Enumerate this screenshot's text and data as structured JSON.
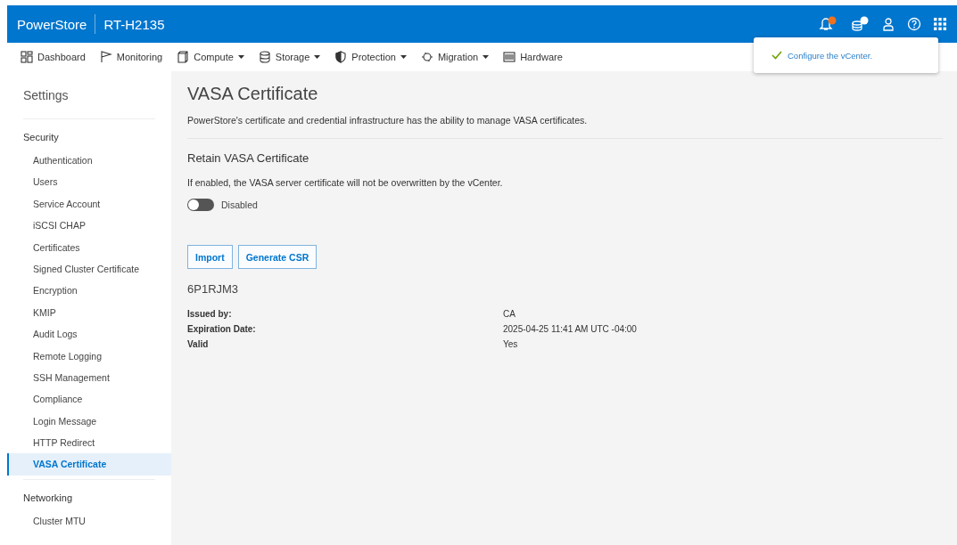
{
  "header": {
    "product": "PowerStore",
    "system": "RT-H2135"
  },
  "nav": [
    {
      "label": "Dashboard",
      "has_menu": false
    },
    {
      "label": "Monitoring",
      "has_menu": false
    },
    {
      "label": "Compute",
      "has_menu": true
    },
    {
      "label": "Storage",
      "has_menu": true
    },
    {
      "label": "Protection",
      "has_menu": true
    },
    {
      "label": "Migration",
      "has_menu": true
    },
    {
      "label": "Hardware",
      "has_menu": false
    }
  ],
  "toast": {
    "message": "Configure the vCenter."
  },
  "sidebar": {
    "title": "Settings",
    "sections": [
      {
        "title": "Security",
        "items": [
          {
            "label": "Authentication",
            "selected": false
          },
          {
            "label": "Users",
            "selected": false
          },
          {
            "label": "Service Account",
            "selected": false
          },
          {
            "label": "iSCSI CHAP",
            "selected": false
          },
          {
            "label": "Certificates",
            "selected": false
          },
          {
            "label": "Signed Cluster Certificate",
            "selected": false
          },
          {
            "label": "Encryption",
            "selected": false
          },
          {
            "label": "KMIP",
            "selected": false
          },
          {
            "label": "Audit Logs",
            "selected": false
          },
          {
            "label": "Remote Logging",
            "selected": false
          },
          {
            "label": "SSH Management",
            "selected": false
          },
          {
            "label": "Compliance",
            "selected": false
          },
          {
            "label": "Login Message",
            "selected": false
          },
          {
            "label": "HTTP Redirect",
            "selected": false
          },
          {
            "label": "VASA Certificate",
            "selected": true
          }
        ]
      },
      {
        "title": "Networking",
        "items": [
          {
            "label": "Cluster MTU",
            "selected": false
          }
        ]
      }
    ]
  },
  "page": {
    "title": "VASA Certificate",
    "description": "PowerStore's certificate and credential infrastructure has the ability to manage VASA certificates.",
    "retain": {
      "title": "Retain VASA Certificate",
      "hint": "If enabled, the VASA server certificate will not be overwritten by the vCenter.",
      "on": false,
      "state_label": "Disabled"
    },
    "buttons": [
      "Import",
      "Generate CSR"
    ],
    "certificate": {
      "name": "6P1RJM3",
      "details": [
        {
          "label": "Issued by:",
          "value": "CA"
        },
        {
          "label": "Expiration Date:",
          "value": "2025-04-25 11:41 AM UTC -04:00"
        },
        {
          "label": "Valid",
          "value": "Yes"
        }
      ]
    }
  }
}
